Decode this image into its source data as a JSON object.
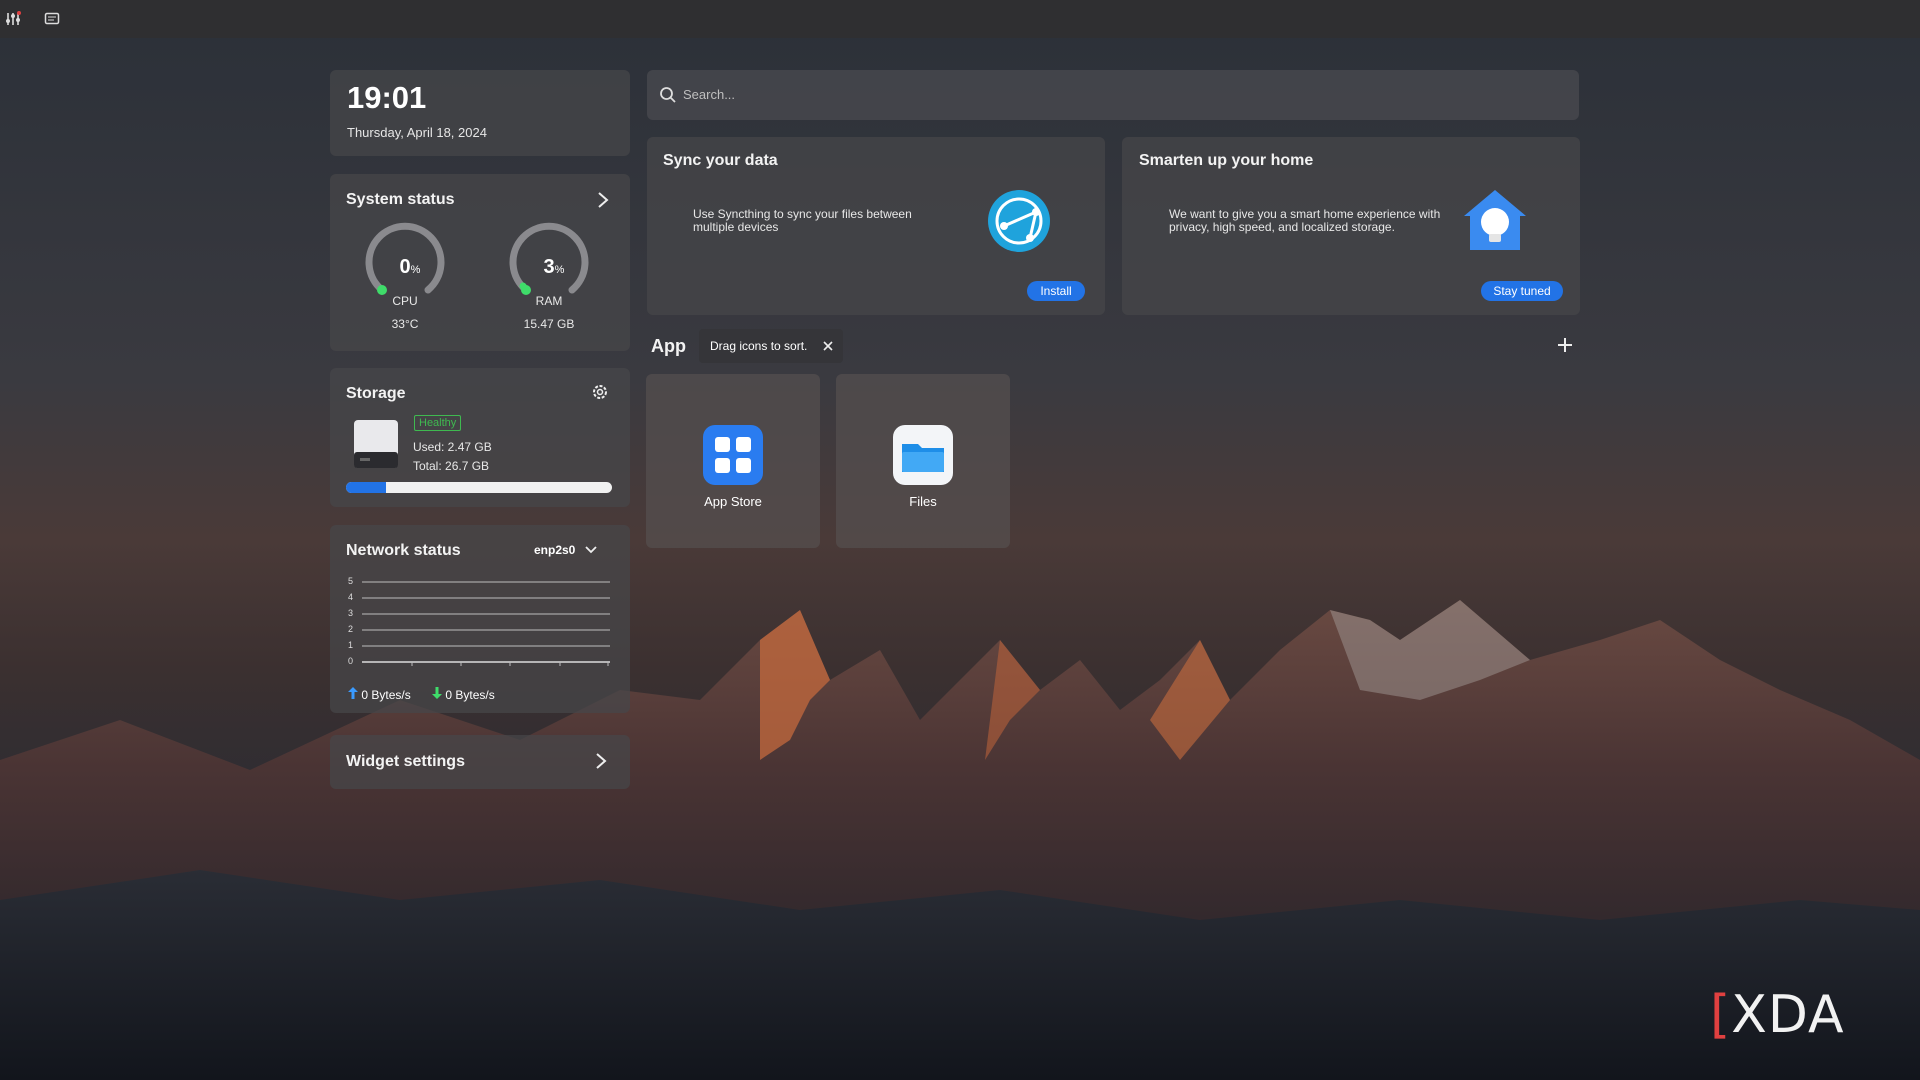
{
  "clock": {
    "time": "19:01",
    "date": "Thursday, April 18, 2024"
  },
  "search": {
    "placeholder": "Search..."
  },
  "system_status": {
    "title": "System status",
    "cpu": {
      "value": "0",
      "unit": "%",
      "label": "CPU",
      "sub": "33°C",
      "percent": 0
    },
    "ram": {
      "value": "3",
      "unit": "%",
      "label": "RAM",
      "sub": "15.47 GB",
      "percent": 3
    }
  },
  "storage": {
    "title": "Storage",
    "badge": "Healthy",
    "used": "Used: 2.47 GB",
    "total": "Total: 26.7 GB",
    "fill_fraction": 0.15
  },
  "network": {
    "title": "Network status",
    "interface": "enp2s0",
    "y_ticks": [
      "5",
      "4",
      "3",
      "2",
      "1",
      "0"
    ],
    "upload": "0 Bytes/s",
    "download": "0 Bytes/s"
  },
  "widget_settings": {
    "title": "Widget settings"
  },
  "promo_sync": {
    "title": "Sync your data",
    "text": "Use Syncthing to sync your files between multiple devices",
    "button": "Install"
  },
  "promo_home": {
    "title": "Smarten up your home",
    "text": "We want to give you a smart home experience with privacy, high speed, and localized storage.",
    "button": "Stay tuned"
  },
  "apps": {
    "title": "App",
    "tooltip": "Drag icons to sort.",
    "items": [
      {
        "label": "App Store"
      },
      {
        "label": "Files"
      }
    ]
  },
  "watermark": "XDA",
  "colors": {
    "accent": "#2273e6",
    "healthy": "#3fb950",
    "gauge_dot": "#3fdc6a"
  }
}
